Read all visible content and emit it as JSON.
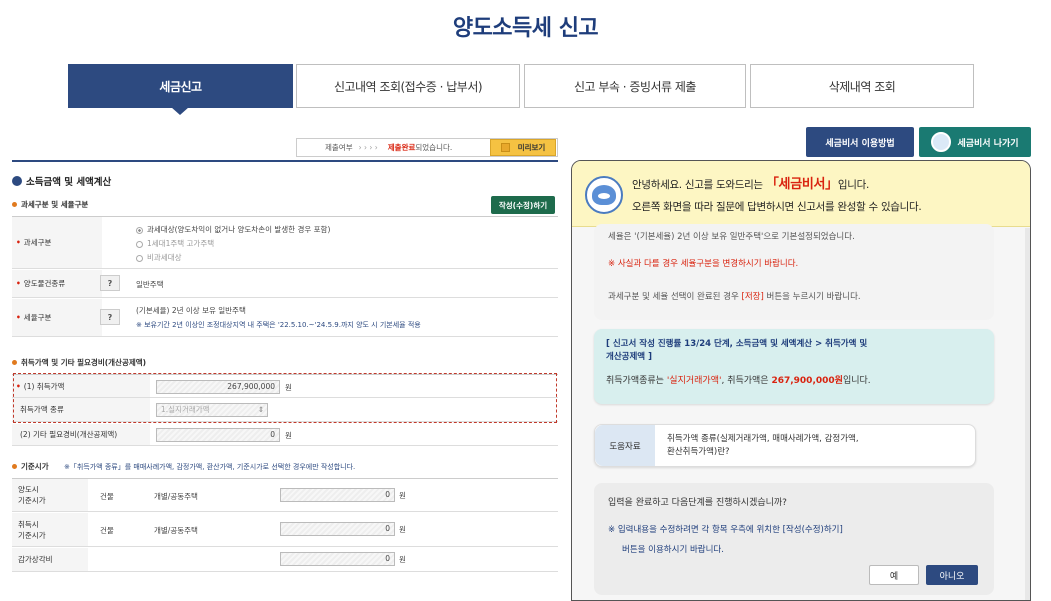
{
  "page_title": "양도소득세 신고",
  "tabs": [
    {
      "label": "세금신고"
    },
    {
      "label": "신고내역 조회(접수증 · 납부서)"
    },
    {
      "label": "신고 부속 · 증빙서류 제출"
    },
    {
      "label": "삭제내역 조회"
    }
  ],
  "status": {
    "prefix": "제출여부",
    "arrows": "› › › ›",
    "done": "제출완료",
    "suffix": "되었습니다."
  },
  "preview_label": "미리보기",
  "left": {
    "section1_title": "소득금액 및 세액계산",
    "sub_tax_class": "과세구분 및 세율구분",
    "edit_label": "작성(수정)하기",
    "rows": {
      "tax_class_label": "과세구분",
      "tax_class_options": [
        "과세대상(양도차익이 없거나 양도차손이 발생한 경우 포함)",
        "1세대1주택 고가주택",
        "비과세대상"
      ],
      "asset_type_label": "양도물건종류",
      "asset_type_value": "일반주택",
      "rate_label": "세율구분",
      "rate_value": "(기본세율) 2년 이상 보유 일반주택",
      "rate_note": "※ 보유기간 2년 이상인 조정대상지역 내 주택은 '22.5.10.~'24.5.9.까지 양도 시 기본세율 적용"
    },
    "sub_acquisition": "취득가액 및 기타 필요경비(개산공제액)",
    "acq_price_label": "(1) 취득가액",
    "acq_price_value": "267,900,000",
    "acq_type_label": "취득가액 종류",
    "acq_type_value": "1.실지거래가액",
    "expense_label": "(2) 기타 필요경비(개산공제액)",
    "expense_value": "0",
    "unit": "원",
    "sub_base": "기준시가",
    "base_note": "※「취득가액 종류」를 매매사례가액, 감정가액, 환산가액, 기준시가로 선택한 경우에만 작성합니다.",
    "base_rows": [
      {
        "label": "양도시\n기준시가",
        "kind": "건물",
        "type": "개별/공동주택",
        "value": "0"
      },
      {
        "label": "취득시\n기준시가",
        "kind": "건물",
        "type": "개별/공동주택",
        "value": "0"
      }
    ],
    "depr_label": "감가상각비",
    "depr_value": "0"
  },
  "right": {
    "help_label": "세금비서 이용방법",
    "exit_label": "세금비서 나가기",
    "greet_1": "안녕하세요. 신고를 도와드리는",
    "greet_name": "「세금비서」",
    "greet_2": "입니다.",
    "greet_line2": "오른쪽 화면을 따라 질문에 답변하시면 신고서를 완성할 수 있습니다.",
    "msg1_line1": "세율은 '(기본세율) 2년 이상 보유 일반주택'으로 기본설정되었습니다.",
    "msg1_warn": "※ 사실과 다를 경우 세율구분을 변경하시기 바랍니다.",
    "msg1_pre": "과세구분 및 세율 선택이 완료된 경우 ",
    "msg1_save": "[저장]",
    "msg1_post": " 버튼을 누르시기 바랍니다.",
    "msg2_title_a": "[ 신고서 작성 진행률 13/24 단계, 소득금액 및 세액계산 > ",
    "msg2_title_b": "취득가액 및",
    "msg2_title_c": "개산공제액",
    "msg2_title_d": " ]",
    "msg2_a": "취득가액종류는 ",
    "msg2_b": "'실지거래가액'",
    "msg2_c": ", 취득가액은 ",
    "msg2_d": "267,900,000원",
    "msg2_e": "입니다.",
    "ref_tag": "도움자료",
    "ref_text1": "취득가액 종류(실제거래가액, 매매사례가액, 감정가액,",
    "ref_text2": "환산취득가액)란?",
    "q_text": "입력을 완료하고 다음단계를 진행하시겠습니까?",
    "q_note1": "※ 입력내용을 수정하려면 각 항목 우측에 위치한 [작성(수정)하기]",
    "q_note2": "버튼을 이용하시기 바랍니다.",
    "yes": "예",
    "no": "아니오"
  }
}
